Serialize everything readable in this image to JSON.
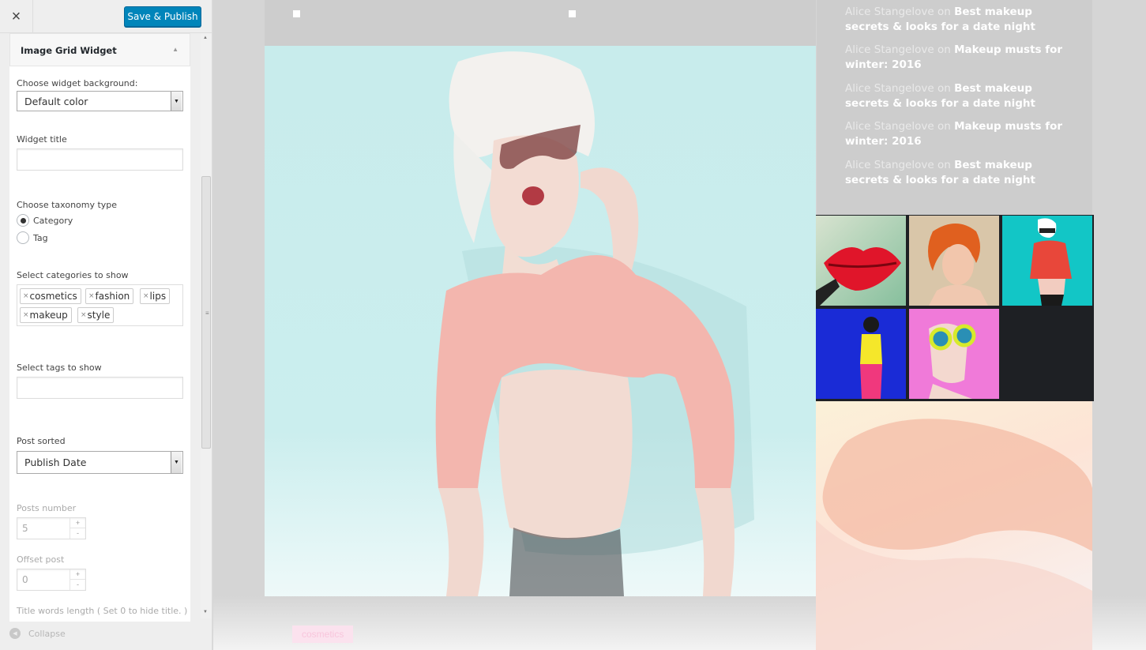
{
  "topbar": {
    "close_icon": "×",
    "publish_label": "Save & Publish"
  },
  "widget": {
    "title": "Image Grid Widget",
    "toggle_icon": "▲",
    "background_label": "Choose widget background:",
    "background_value": "Default color",
    "title_label": "Widget title",
    "title_value": "",
    "taxonomy_label": "Choose taxonomy type",
    "taxonomy_options": [
      "Category",
      "Tag"
    ],
    "taxonomy_selected": "Category",
    "categories_label": "Select categories to show",
    "categories": [
      "cosmetics",
      "fashion",
      "lips",
      "makeup",
      "style"
    ],
    "tags_label": "Select tags to show",
    "sort_label": "Post sorted",
    "sort_value": "Publish Date",
    "posts_number_label": "Posts number",
    "posts_number_value": "5",
    "offset_label": "Offset post",
    "offset_value": "0",
    "title_length_label": "Title words length ( Set 0 to hide title. )"
  },
  "footer": {
    "collapse_label": "Collapse"
  },
  "preview": {
    "hero_tag": "cosmetics",
    "comments": [
      {
        "author": "Alice Stangelove",
        "on": "on",
        "title": "Best makeup secrets & looks for a date night"
      },
      {
        "author": "Alice Stangelove",
        "on": "on",
        "title": "Makeup musts for winter: 2016"
      },
      {
        "author": "Alice Stangelove",
        "on": "on",
        "title": "Best makeup secrets & looks for a date night"
      },
      {
        "author": "Alice Stangelove",
        "on": "on",
        "title": "Makeup musts for winter: 2016"
      },
      {
        "author": "Alice Stangelove",
        "on": "on",
        "title": "Best makeup secrets & looks for a date night"
      }
    ],
    "grid_images": [
      "red-lips-photo",
      "orange-hair-portrait-photo",
      "red-sweater-sunglasses-photo",
      "yellow-top-blue-backdrop-photo",
      "yellow-glasses-pink-backdrop-photo"
    ]
  },
  "colors": {
    "accent": "#0085ba",
    "preview_bg": "#d5d5d5",
    "grid_bg": "#1e2024"
  }
}
